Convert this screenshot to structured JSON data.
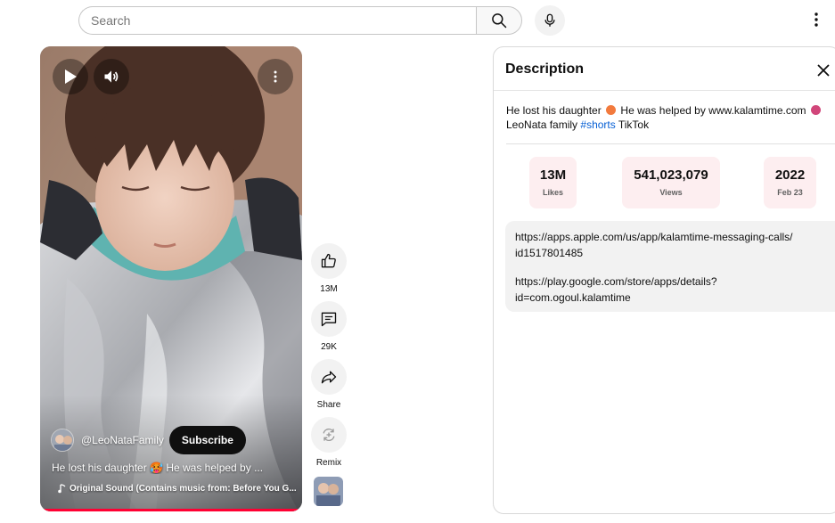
{
  "header": {
    "search_placeholder": "Search",
    "search_value": ""
  },
  "video": {
    "channel_name": "@LeoNataFamily",
    "subscribe_label": "Subscribe",
    "caption": "He lost his daughter 🥵 He was helped by ...",
    "sound": "Original Sound (Contains music from: Before You G...",
    "progress_fraction": 1.0
  },
  "actions": {
    "like_label": "13M",
    "comments_label": "29K",
    "share_label": "Share",
    "remix_label": "Remix"
  },
  "description": {
    "title": "Description",
    "text_part1": "He lost his daughter",
    "text_part2": "He was helped by www.kalamtime.com",
    "text_part3": "LeoNata family",
    "hashtag": "#shorts",
    "text_part4": "TikTok",
    "stats": {
      "likes_value": "13M",
      "likes_label": "Likes",
      "views_value": "541,023,079",
      "views_label": "Views",
      "year_value": "2022",
      "date_label": "Feb 23"
    },
    "links": {
      "apple_line1": "https://apps.apple.com/us/app/kalamtime-messaging-calls/",
      "apple_line2": "id1517801485",
      "google_line1": "https://play.google.com/store/apps/details?",
      "google_line2": "id=com.ogoul.kalamtime"
    }
  },
  "colors": {
    "accent_red": "#ff0033",
    "hashtag_blue": "#065fd4",
    "stat_bg": "#fdeef0"
  }
}
